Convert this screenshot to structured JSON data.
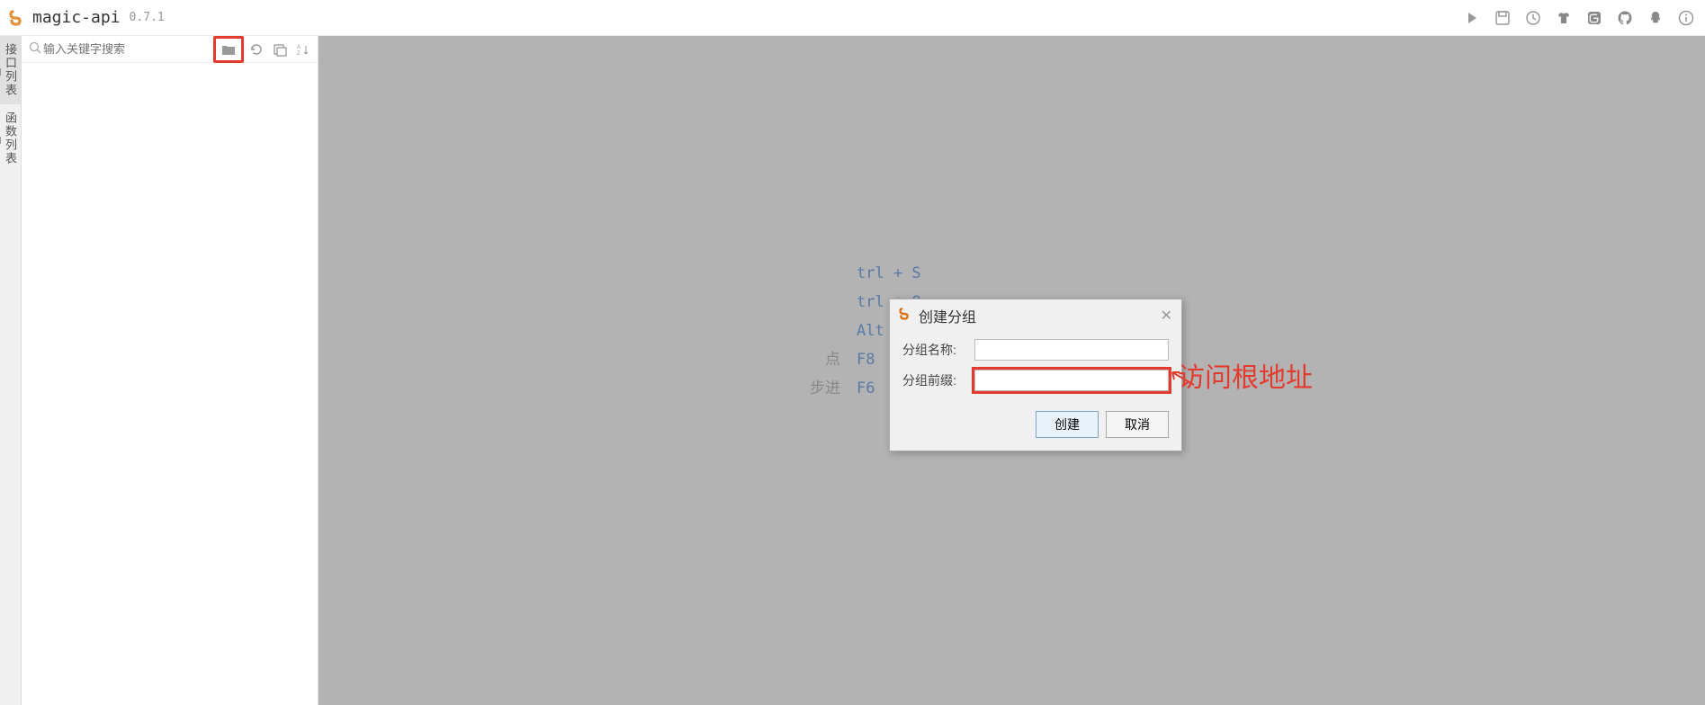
{
  "header": {
    "title": "magic-api",
    "version": "0.7.1"
  },
  "leftTabs": {
    "tab1": "接口列表",
    "tab2": "函数列表"
  },
  "sidebar": {
    "searchPlaceholder": "输入关键字搜索"
  },
  "shortcuts": {
    "row1": {
      "label": "",
      "key": "trl + S"
    },
    "row2": {
      "label": "",
      "key": "trl + Q"
    },
    "row3": {
      "label": "",
      "key": "Alt + /"
    },
    "row4": {
      "label": "点",
      "key": "F8"
    },
    "row5": {
      "label": "步进",
      "key": "F6"
    }
  },
  "dialog": {
    "title": "创建分组",
    "label1": "分组名称:",
    "label2": "分组前缀:",
    "value1": "",
    "value2": "",
    "btnOk": "创建",
    "btnCancel": "取消"
  },
  "annotation": {
    "text": "访问根地址"
  }
}
